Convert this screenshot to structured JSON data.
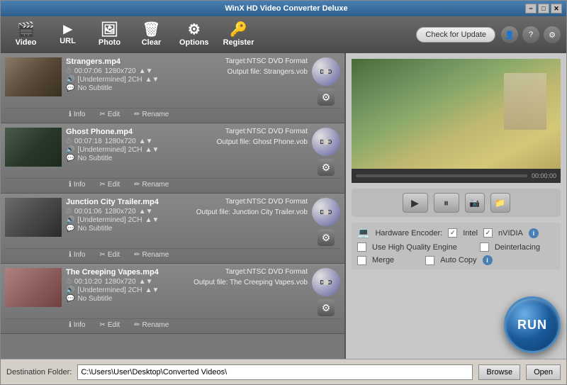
{
  "window": {
    "title": "WinX HD Video Converter Deluxe"
  },
  "titlebar": {
    "minimize": "−",
    "maximize": "□",
    "close": "✕"
  },
  "toolbar": {
    "video_label": "Video",
    "url_label": "URL",
    "photo_label": "Photo",
    "clear_label": "Clear",
    "options_label": "Options",
    "register_label": "Register",
    "check_update": "Check for Update"
  },
  "files": [
    {
      "name": "Strangers.mp4",
      "duration": "00:07:06",
      "resolution": "1280x720",
      "audio": "[Undetermined] 2CH",
      "subtitle": "No Subtitle",
      "target": "Target:NTSC DVD Format",
      "output": "Output file:",
      "output_file": "Strangers.vob",
      "thumb_class": "thumb-1"
    },
    {
      "name": "Ghost Phone.mp4",
      "duration": "00:07:18",
      "resolution": "1280x720",
      "audio": "[Undetermined] 2CH",
      "subtitle": "No Subtitle",
      "target": "Target:NTSC DVD Format",
      "output": "Output file:",
      "output_file": "Ghost Phone.vob",
      "thumb_class": "thumb-2"
    },
    {
      "name": "Junction City Trailer.mp4",
      "duration": "00:01:06",
      "resolution": "1280x720",
      "audio": "[Undetermined] 2CH",
      "subtitle": "No Subtitle",
      "target": "Target:NTSC DVD Format",
      "output": "Output file:",
      "output_file": "Junction City Trailer.vob",
      "thumb_class": "thumb-3"
    },
    {
      "name": "The Creeping Vapes.mp4",
      "duration": "00:10:20",
      "resolution": "1280x720",
      "audio": "[Undetermined] 2CH",
      "subtitle": "No Subtitle",
      "target": "Target:NTSC DVD Format",
      "output": "Output file:",
      "output_file": "The Creeping Vapes.vob",
      "thumb_class": "thumb-4"
    }
  ],
  "actions": {
    "info": "Info",
    "edit": "Edit",
    "rename": "Rename"
  },
  "player": {
    "time": "00:00:00"
  },
  "options": {
    "hw_encoder_label": "Hardware Encoder:",
    "intel_label": "Intel",
    "nvidia_label": "nVIDIA",
    "high_quality_label": "Use High Quality Engine",
    "deinterlacing_label": "Deinterlacing",
    "merge_label": "Merge",
    "auto_copy_label": "Auto Copy"
  },
  "run_btn_label": "RUN",
  "bottom": {
    "dest_label": "Destination Folder:",
    "dest_path": "C:\\Users\\User\\Desktop\\Converted Videos\\",
    "browse_label": "Browse",
    "open_label": "Open"
  }
}
